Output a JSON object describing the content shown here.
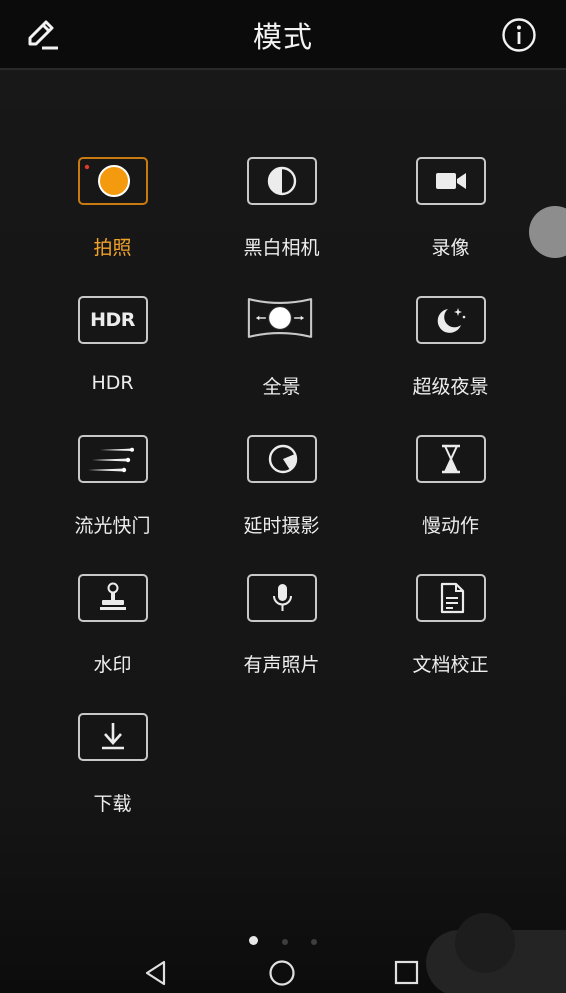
{
  "header": {
    "title": "模式"
  },
  "modes": [
    {
      "label": "拍照",
      "icon": "photo-icon",
      "active": true
    },
    {
      "label": "黑白相机",
      "icon": "monochrome-icon",
      "active": false
    },
    {
      "label": "录像",
      "icon": "video-camera-icon",
      "active": false
    },
    {
      "label": "HDR",
      "icon": "hdr-icon",
      "icon_text": "HDR",
      "active": false
    },
    {
      "label": "全景",
      "icon": "panorama-icon",
      "active": false
    },
    {
      "label": "超级夜景",
      "icon": "night-moon-icon",
      "active": false
    },
    {
      "label": "流光快门",
      "icon": "light-trails-icon",
      "active": false
    },
    {
      "label": "延时摄影",
      "icon": "timelapse-icon",
      "active": false
    },
    {
      "label": "慢动作",
      "icon": "hourglass-icon",
      "active": false
    },
    {
      "label": "水印",
      "icon": "stamp-icon",
      "active": false
    },
    {
      "label": "有声照片",
      "icon": "microphone-icon",
      "active": false
    },
    {
      "label": "文档校正",
      "icon": "document-icon",
      "active": false
    },
    {
      "label": "下载",
      "icon": "download-icon",
      "active": false
    }
  ],
  "pager": {
    "pages": 3,
    "current": 1
  },
  "colors": {
    "accent": "#f0a22a",
    "accent_fill": "#f39a0f",
    "text": "#ededed",
    "background": "#151515"
  }
}
